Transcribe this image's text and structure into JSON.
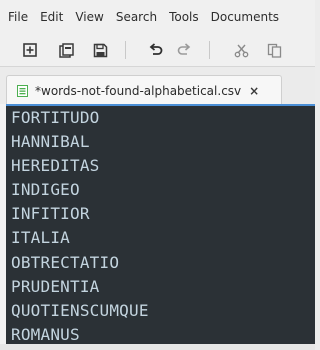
{
  "menu": [
    "File",
    "Edit",
    "View",
    "Search",
    "Tools",
    "Documents"
  ],
  "toolbar": {
    "buttons": [
      "new-file-icon",
      "open-file-icon",
      "save-icon",
      "undo-icon",
      "redo-icon",
      "cut-icon",
      "copy-icon"
    ]
  },
  "tab": {
    "label": "*words-not-found-alphabetical.csv",
    "close": "×",
    "icon": "text-file-icon"
  },
  "editor": {
    "lines": [
      "FORTITUDO",
      "HANNIBAL",
      "HEREDITAS",
      "INDIGEO",
      "INFITIOR",
      "ITALIA",
      "OBTRECTATIO",
      "PRUDENTIA",
      "QUOTIENSCUMQUE",
      "ROMANUS"
    ]
  },
  "colors": {
    "editor_background": "#2b3136",
    "editor_text": "#c3d4df",
    "tab_icon": "#4caf50",
    "focus_border": "#4b8fd6"
  }
}
